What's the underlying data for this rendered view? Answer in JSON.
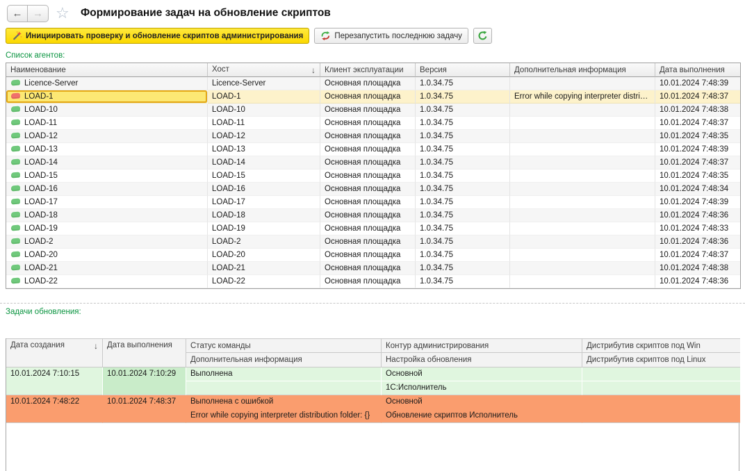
{
  "header": {
    "title": "Формирование задач на обновление скриптов",
    "back_icon": "←",
    "forward_icon": "→",
    "favorite_icon": "☆"
  },
  "toolbar": {
    "init_button_label": "Инициировать проверку и обновление скриптов администрирования",
    "restart_button_label": "Перезапустить последнюю задачу",
    "init_icon": "magic-wand",
    "restart_icon": "green-red-cycle-arrows",
    "refresh_icon": "green-circular-arrow"
  },
  "agents": {
    "section_label": "Список агентов:",
    "columns": [
      "Наименование",
      "Хост",
      "Клиент эксплуатации",
      "Версия",
      "Дополнительная информация",
      "Дата выполнения"
    ],
    "sort": {
      "column": "Хост",
      "direction_icon": "↓"
    },
    "rows": [
      {
        "name": "Licence-Server",
        "host": "Licence-Server",
        "client": "Основная площадка",
        "version": "1.0.34.75",
        "info": "",
        "date": "10.01.2024 7:48:39",
        "status": "ok",
        "selected": false
      },
      {
        "name": "LOAD-1",
        "host": "LOAD-1",
        "client": "Основная площадка",
        "version": "1.0.34.75",
        "info": "Error while copying interpreter distribution folder: {}",
        "date": "10.01.2024 7:48:37",
        "status": "error",
        "selected": true
      },
      {
        "name": "LOAD-10",
        "host": "LOAD-10",
        "client": "Основная площадка",
        "version": "1.0.34.75",
        "info": "",
        "date": "10.01.2024 7:48:38",
        "status": "ok",
        "selected": false
      },
      {
        "name": "LOAD-11",
        "host": "LOAD-11",
        "client": "Основная площадка",
        "version": "1.0.34.75",
        "info": "",
        "date": "10.01.2024 7:48:37",
        "status": "ok",
        "selected": false
      },
      {
        "name": "LOAD-12",
        "host": "LOAD-12",
        "client": "Основная площадка",
        "version": "1.0.34.75",
        "info": "",
        "date": "10.01.2024 7:48:35",
        "status": "ok",
        "selected": false
      },
      {
        "name": "LOAD-13",
        "host": "LOAD-13",
        "client": "Основная площадка",
        "version": "1.0.34.75",
        "info": "",
        "date": "10.01.2024 7:48:39",
        "status": "ok",
        "selected": false
      },
      {
        "name": "LOAD-14",
        "host": "LOAD-14",
        "client": "Основная площадка",
        "version": "1.0.34.75",
        "info": "",
        "date": "10.01.2024 7:48:37",
        "status": "ok",
        "selected": false
      },
      {
        "name": "LOAD-15",
        "host": "LOAD-15",
        "client": "Основная площадка",
        "version": "1.0.34.75",
        "info": "",
        "date": "10.01.2024 7:48:35",
        "status": "ok",
        "selected": false
      },
      {
        "name": "LOAD-16",
        "host": "LOAD-16",
        "client": "Основная площадка",
        "version": "1.0.34.75",
        "info": "",
        "date": "10.01.2024 7:48:34",
        "status": "ok",
        "selected": false
      },
      {
        "name": "LOAD-17",
        "host": "LOAD-17",
        "client": "Основная площадка",
        "version": "1.0.34.75",
        "info": "",
        "date": "10.01.2024 7:48:39",
        "status": "ok",
        "selected": false
      },
      {
        "name": "LOAD-18",
        "host": "LOAD-18",
        "client": "Основная площадка",
        "version": "1.0.34.75",
        "info": "",
        "date": "10.01.2024 7:48:36",
        "status": "ok",
        "selected": false
      },
      {
        "name": "LOAD-19",
        "host": "LOAD-19",
        "client": "Основная площадка",
        "version": "1.0.34.75",
        "info": "",
        "date": "10.01.2024 7:48:33",
        "status": "ok",
        "selected": false
      },
      {
        "name": "LOAD-2",
        "host": "LOAD-2",
        "client": "Основная площадка",
        "version": "1.0.34.75",
        "info": "",
        "date": "10.01.2024 7:48:36",
        "status": "ok",
        "selected": false
      },
      {
        "name": "LOAD-20",
        "host": "LOAD-20",
        "client": "Основная площадка",
        "version": "1.0.34.75",
        "info": "",
        "date": "10.01.2024 7:48:37",
        "status": "ok",
        "selected": false
      },
      {
        "name": "LOAD-21",
        "host": "LOAD-21",
        "client": "Основная площадка",
        "version": "1.0.34.75",
        "info": "",
        "date": "10.01.2024 7:48:38",
        "status": "ok",
        "selected": false
      },
      {
        "name": "LOAD-22",
        "host": "LOAD-22",
        "client": "Основная площадка",
        "version": "1.0.34.75",
        "info": "",
        "date": "10.01.2024 7:48:36",
        "status": "ok",
        "selected": false
      }
    ]
  },
  "tasks": {
    "section_label": "Задачи обновления:",
    "header": {
      "col_created": "Дата создания",
      "sort_icon": "↓",
      "col_executed": "Дата выполнения",
      "col_status": "Статус команды",
      "col_info": "Дополнительная информация",
      "col_contour": "Контур администрирования",
      "col_setting": "Настройка обновления",
      "col_win": "Дистрибутив скриптов под Win",
      "col_linux": "Дистрибутив скриптов под Linux"
    },
    "rows": [
      {
        "created": "10.01.2024 7:10:15",
        "executed": "10.01.2024 7:10:29",
        "status": "Выполнена",
        "info": "",
        "contour": "Основной",
        "setting": "1С:Исполнитель",
        "win": "",
        "linux": "",
        "state": "success"
      },
      {
        "created": "10.01.2024 7:48:22",
        "executed": "10.01.2024 7:48:37",
        "status": "Выполнена с ошибкой",
        "info": "Error while copying interpreter distribution folder: {}",
        "contour": "Основной",
        "setting": "Обновление скриптов Исполнитель",
        "win": "",
        "linux": "",
        "state": "error"
      }
    ]
  },
  "colors": {
    "accent_yellow": "#fbdf1e",
    "selected_cell": "#fce874",
    "selected_cell_border": "#e3a713",
    "selected_row": "#fdf2cb",
    "success_row": "#e0f6df",
    "success_executed_cell": "#c9ecc9",
    "error_row": "#fa9d6e",
    "section_label_green": "#0a9440",
    "agent_ok_icon": "#70c97c",
    "agent_error_icon": "#f0716c",
    "refresh_green": "#3aa63f"
  }
}
